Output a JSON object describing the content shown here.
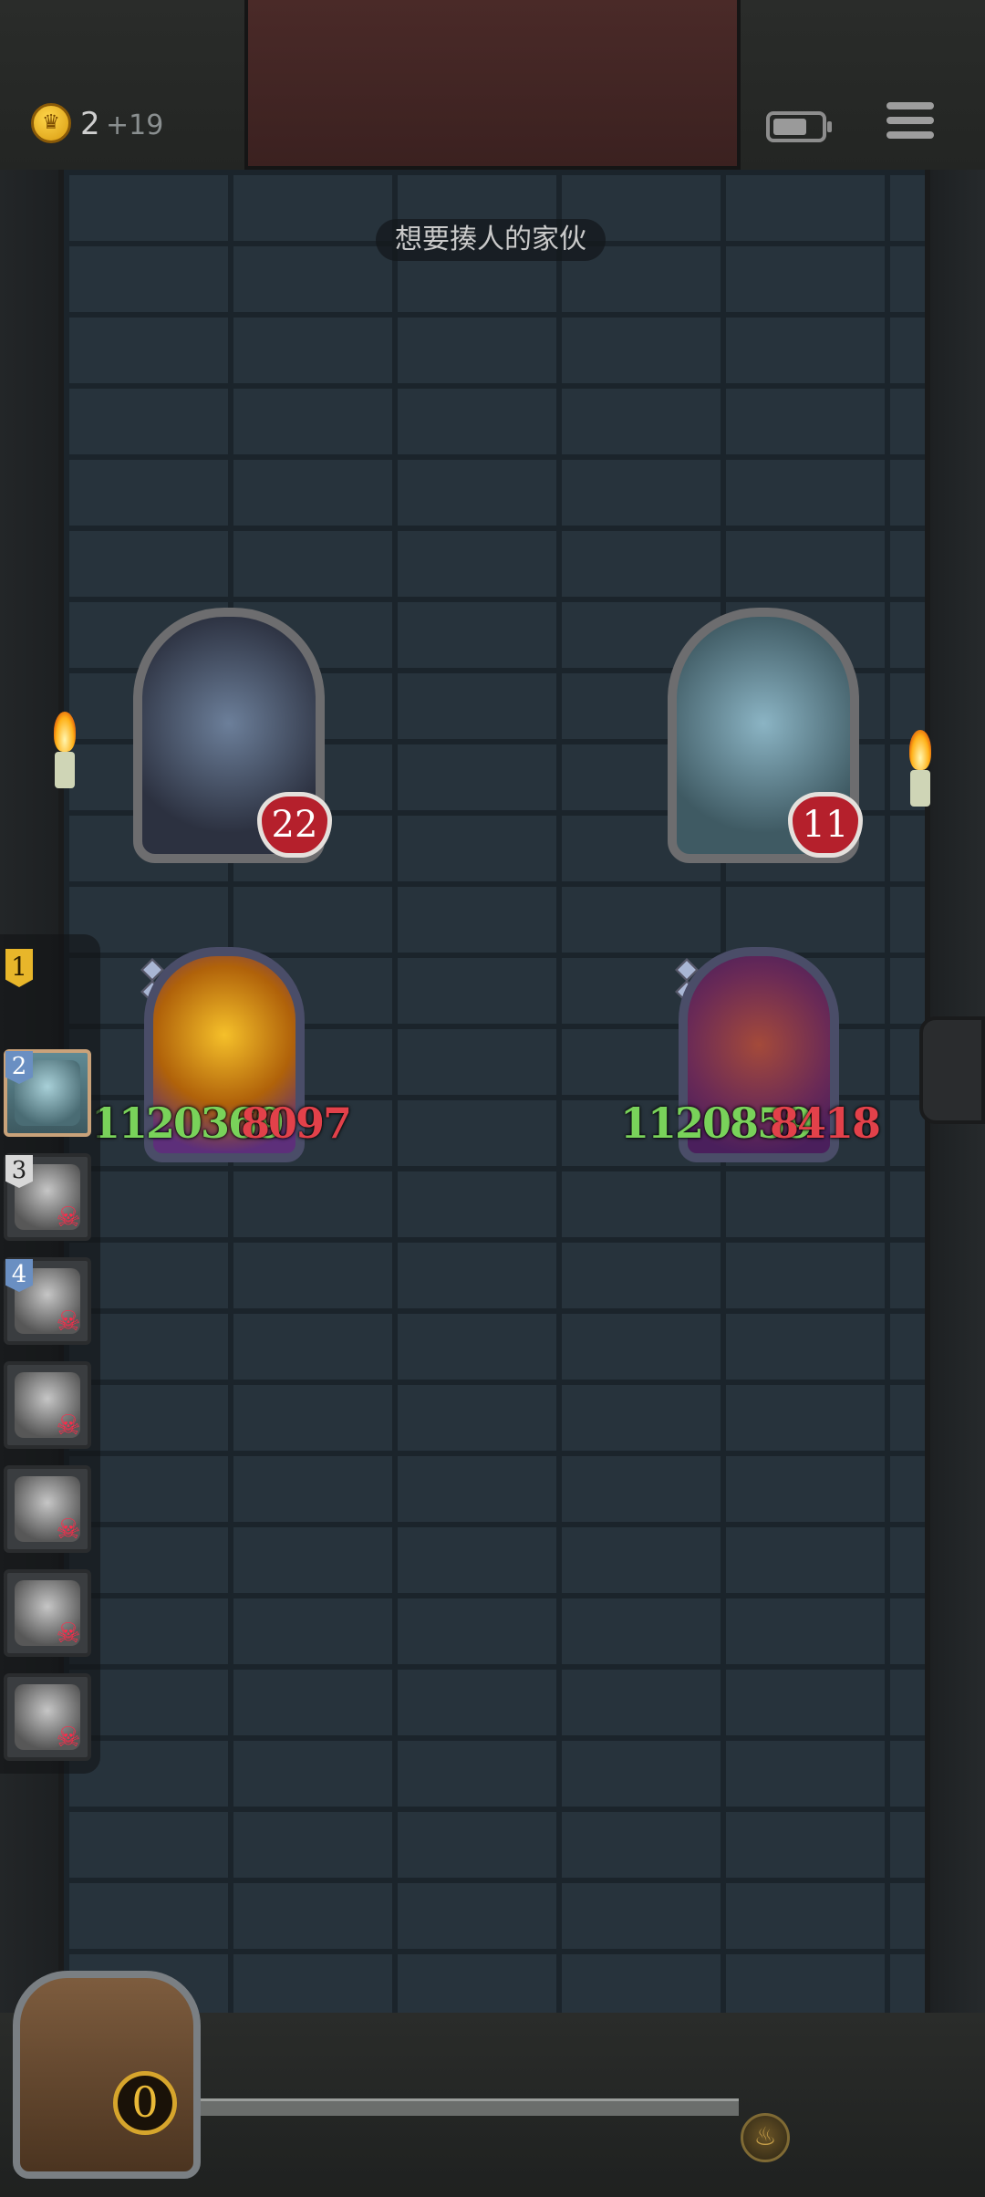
{
  "header": {
    "coin_count": "2",
    "coin_bonus": "+19",
    "coin_icon": "crown-coin-icon",
    "battery_icon": "battery-icon",
    "menu_icon": "menu-icon"
  },
  "encounter_title": "想要揍人的家伙",
  "heroes": [
    {
      "name_icon": "top-hat-robot-portrait",
      "hp": "22"
    },
    {
      "name_icon": "stitched-zombie-portrait",
      "hp": "11"
    }
  ],
  "cards": [
    {
      "icon": "golden-demon-card",
      "attack": "1120369",
      "health": "8097"
    },
    {
      "icon": "serpent-demon-card",
      "attack": "1120859",
      "health": "8418"
    }
  ],
  "roster": {
    "rank_1": "1",
    "slots": [
      {
        "number": "2",
        "status": "alive"
      },
      {
        "number": "3",
        "status": "dead"
      },
      {
        "number": "4",
        "status": "dead"
      },
      {
        "number": "",
        "status": "dead"
      },
      {
        "number": "",
        "status": "dead"
      },
      {
        "number": "",
        "status": "dead"
      },
      {
        "number": "",
        "status": "dead"
      }
    ],
    "skull_glyph": "☠"
  },
  "footer": {
    "deck_count": "0",
    "flame_glyph": "♨"
  },
  "colors": {
    "attack": "#79d25a",
    "health": "#e2414a",
    "hp_badge": "#b5202c",
    "coin": "#ffd64a"
  }
}
